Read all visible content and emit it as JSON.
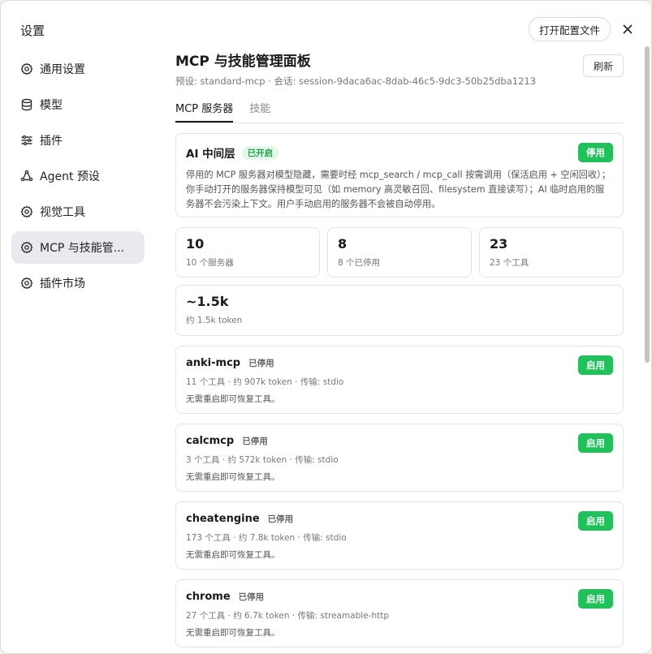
{
  "sidebar": {
    "title": "设置",
    "items": [
      {
        "label": "通用设置",
        "icon": "gear-icon"
      },
      {
        "label": "模型",
        "icon": "database-icon"
      },
      {
        "label": "插件",
        "icon": "sliders-icon"
      },
      {
        "label": "Agent 预设",
        "icon": "agent-icon"
      },
      {
        "label": "视觉工具",
        "icon": "gear-icon"
      },
      {
        "label": "MCP 与技能管...",
        "icon": "gear-icon",
        "active": true
      },
      {
        "label": "插件市场",
        "icon": "gear-icon"
      }
    ]
  },
  "header": {
    "open_config_label": "打开配置文件",
    "close_icon": "close-icon"
  },
  "main": {
    "title": "MCP 与技能管理面板",
    "subtitle": "预设: standard-mcp · 会话: session-9daca6ac-8dab-46c5-9dc3-50b25dba1213",
    "refresh_label": "刷新",
    "tabs": [
      {
        "label": "MCP 服务器",
        "active": true
      },
      {
        "label": "技能",
        "active": false
      }
    ]
  },
  "middleware": {
    "title": "AI 中间层",
    "badge": "已开启",
    "button": "停用",
    "description": "停用的 MCP 服务器对模型隐藏，需要时经 mcp_search / mcp_call 按需调用（保活启用 + 空闲回收）；你手动打开的服务器保持模型可见（如 memory 高灵敏召回、filesystem 直接读写）；AI 临时启用的服务器不会污染上下文。用户手动启用的服务器不会被自动停用。"
  },
  "stats": [
    {
      "value": "10",
      "label": "10 个服务器"
    },
    {
      "value": "8",
      "label": "8 个已停用"
    },
    {
      "value": "23",
      "label": "23 个工具"
    }
  ],
  "token": {
    "value": "~1.5k",
    "label": "约 1.5k token"
  },
  "servers": [
    {
      "name": "anki-mcp",
      "status": "已停用",
      "button": "启用",
      "meta": "11 个工具 · 约 907k token · 传输: stdio",
      "note": "无需重启即可恢复工具。"
    },
    {
      "name": "calcmcp",
      "status": "已停用",
      "button": "启用",
      "meta": "3 个工具 · 约 572k token · 传输: stdio",
      "note": "无需重启即可恢复工具。"
    },
    {
      "name": "cheatengine",
      "status": "已停用",
      "button": "启用",
      "meta": "173 个工具 · 约 7.8k token · 传输: stdio",
      "note": "无需重启即可恢复工具。"
    },
    {
      "name": "chrome",
      "status": "已停用",
      "button": "启用",
      "meta": "27 个工具 · 约 6.7k token · 传输: streamable-http",
      "note": "无需重启即可恢复工具。"
    }
  ],
  "colors": {
    "accent_green": "#22c05a",
    "badge_on_bg": "#e6f6ea",
    "active_nav_bg": "#e8eaef"
  }
}
